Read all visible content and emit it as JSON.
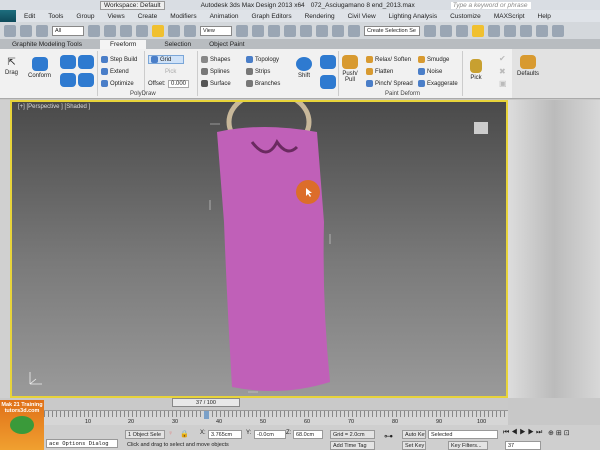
{
  "title": {
    "workspace": "Workspace: Default",
    "app": "Autodesk 3ds Max Design 2013 x64",
    "file": "072_Asciugamano 8 end_2013.max",
    "search_placeholder": "Type a keyword or phrase"
  },
  "menu": [
    "Edit",
    "Tools",
    "Group",
    "Views",
    "Create",
    "Modifiers",
    "Animation",
    "Graph Editors",
    "Rendering",
    "Civil View",
    "Lighting Analysis",
    "Customize",
    "MAXScript",
    "Help"
  ],
  "toolbar": {
    "filter": "All",
    "ref_coord": "View",
    "selection_set": "Create Selection Se"
  },
  "ribbon_tabs": [
    "Graphite Modeling Tools",
    "Freeform",
    "Selection",
    "Object Paint"
  ],
  "ribbon": {
    "drag": "Drag",
    "conform": "Conform",
    "step_build": "Step Build",
    "extend": "Extend",
    "optimize": "Optimize",
    "grid": "Grid",
    "pick": "Pick",
    "offset_label": "Offset:",
    "offset_value": "0.000",
    "shapes": "Shapes",
    "splines": "Splines",
    "surface": "Surface",
    "topology": "Topology",
    "strips": "Strips",
    "branches": "Branches",
    "polydraw": "PolyDraw",
    "shift": "Shift",
    "push_pull": "Push/ Pull",
    "relax": "Relax/ Soften",
    "flatten": "Flatten",
    "pinch": "Pinch/ Spread",
    "smudge": "Smudge",
    "noise": "Noise",
    "exaggerate": "Exaggerate",
    "paint_deform": "Paint Deform",
    "pick2": "Pick",
    "defaults": "Defaults"
  },
  "viewport": {
    "label": "[+] [Perspective ] [Shaded ]"
  },
  "timeline": {
    "frame": "37 / 100",
    "current": 37,
    "total": 100,
    "ticks": [
      "10",
      "20",
      "30",
      "40",
      "50",
      "60",
      "70",
      "80",
      "90",
      "100"
    ]
  },
  "status": {
    "watermark": "Mak 21 Training tutors3d.com",
    "listener": "ace Options Dialog",
    "selected": "1 Object Sele",
    "x": "3.765cm",
    "y": "-0.0cm",
    "z": "68.0cm",
    "grid": "Grid = 2.0cm",
    "prompt": "Click and drag to select and move objects",
    "add_time_tag": "Add Time Tag",
    "auto_key": "Auto Key",
    "set_key": "Set Key",
    "key_mode": "Selected",
    "key_filters": "Key Filters...",
    "frame": "37"
  }
}
